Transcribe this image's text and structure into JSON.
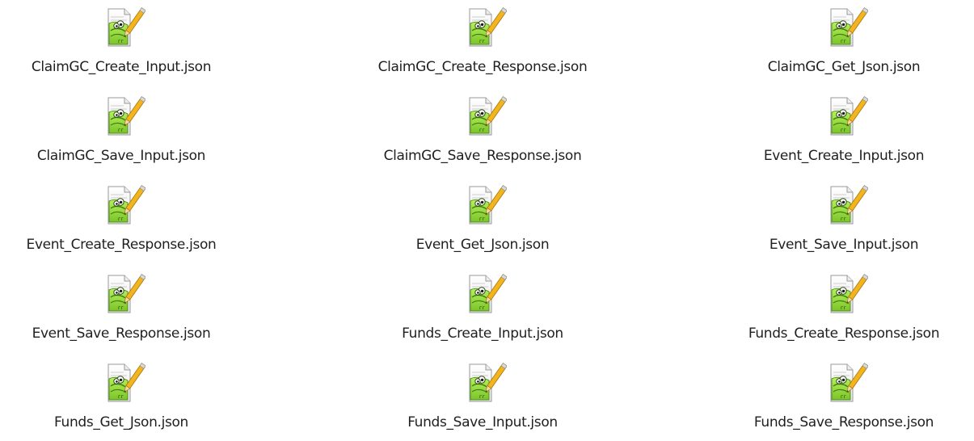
{
  "window": {
    "title": ""
  },
  "files": {
    "icon": "notepad-plus-plus-file-icon",
    "items": [
      {
        "name": "ClaimGC_Create_Input.json"
      },
      {
        "name": "ClaimGC_Create_Response.json"
      },
      {
        "name": "ClaimGC_Get_Json.json"
      },
      {
        "name": "ClaimGC_Save_Input.json"
      },
      {
        "name": "ClaimGC_Save_Response.json"
      },
      {
        "name": "Event_Create_Input.json"
      },
      {
        "name": "Event_Create_Response.json"
      },
      {
        "name": "Event_Get_Json.json"
      },
      {
        "name": "Event_Save_Input.json"
      },
      {
        "name": "Event_Save_Response.json"
      },
      {
        "name": "Funds_Create_Input.json"
      },
      {
        "name": "Funds_Create_Response.json"
      },
      {
        "name": "Funds_Get_Json.json"
      },
      {
        "name": "Funds_Save_Input.json"
      },
      {
        "name": "Funds_Save_Response.json"
      }
    ]
  },
  "colors": {
    "background": "#ffffff",
    "text": "#1f1f1f",
    "icon_green": "#7bc42a",
    "icon_green_dark": "#3e7d12",
    "pencil_yellow": "#f2b51d"
  }
}
